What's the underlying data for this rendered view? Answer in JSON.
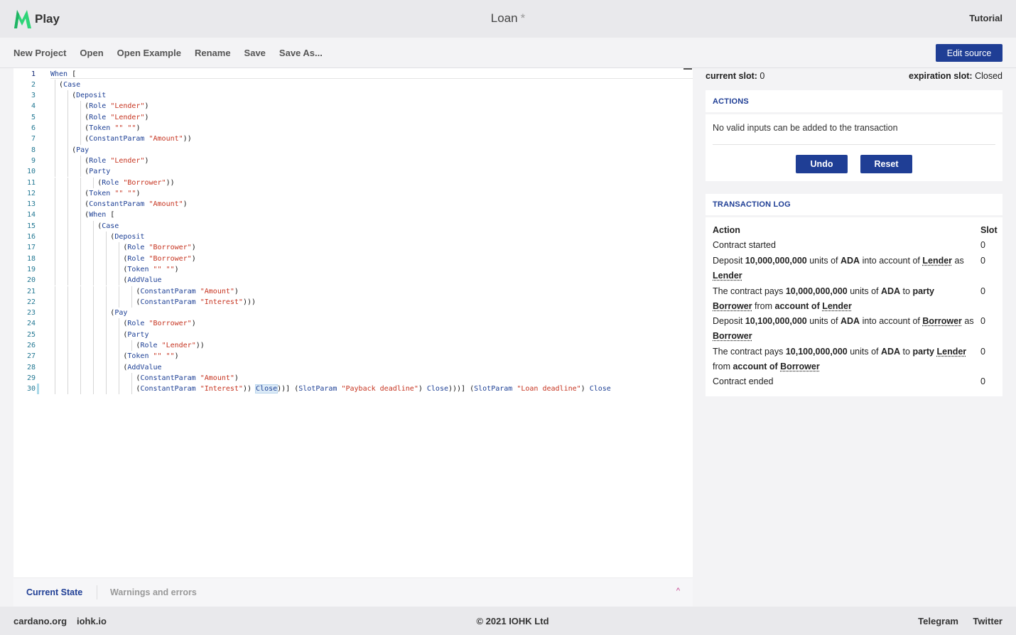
{
  "header": {
    "logo_text": "Play",
    "title": "Loan",
    "dirty_marker": "*",
    "tutorial": "Tutorial"
  },
  "toolbar": {
    "menu": [
      "New Project",
      "Open",
      "Open Example",
      "Rename",
      "Save",
      "Save As..."
    ],
    "edit_source": "Edit source"
  },
  "editor": {
    "lines": [
      "When [",
      "  (Case",
      "     (Deposit",
      "        (Role \"Lender\")",
      "        (Role \"Lender\")",
      "        (Token \"\" \"\")",
      "        (ConstantParam \"Amount\"))",
      "     (Pay",
      "        (Role \"Lender\")",
      "        (Party",
      "           (Role \"Borrower\"))",
      "        (Token \"\" \"\")",
      "        (ConstantParam \"Amount\")",
      "        (When [",
      "           (Case",
      "              (Deposit",
      "                 (Role \"Borrower\")",
      "                 (Role \"Borrower\")",
      "                 (Token \"\" \"\")",
      "                 (AddValue",
      "                    (ConstantParam \"Amount\")",
      "                    (ConstantParam \"Interest\")))",
      "              (Pay",
      "                 (Role \"Borrower\")",
      "                 (Party",
      "                    (Role \"Lender\"))",
      "                 (Token \"\" \"\")",
      "                 (AddValue",
      "                    (ConstantParam \"Amount\")",
      "                    (ConstantParam \"Interest\")) Close))] (SlotParam \"Payback deadline\") Close)))] (SlotParam \"Loan deadline\") Close"
    ]
  },
  "bottom_panel": {
    "tab_current": "Current State",
    "tab_warnings": "Warnings and errors",
    "chevron": "^"
  },
  "slots": {
    "current_label": "current slot:",
    "current_value": "0",
    "expiration_label": "expiration slot:",
    "expiration_value": "Closed"
  },
  "actions": {
    "heading": "ACTIONS",
    "message": "No valid inputs can be added to the transaction",
    "undo": "Undo",
    "reset": "Reset"
  },
  "transaction_log": {
    "heading": "TRANSACTION LOG",
    "col_action": "Action",
    "col_slot": "Slot",
    "rows": [
      {
        "slot": "0",
        "parts": [
          [
            "t",
            "Contract started"
          ]
        ]
      },
      {
        "slot": "0",
        "parts": [
          [
            "t",
            "Deposit "
          ],
          [
            "b",
            "10,000,000,000"
          ],
          [
            "t",
            " units of "
          ],
          [
            "b",
            "ADA"
          ],
          [
            "t",
            " into account of "
          ],
          [
            "u",
            "Lender"
          ],
          [
            "t",
            " as "
          ],
          [
            "u",
            "Lender"
          ]
        ]
      },
      {
        "slot": "0",
        "parts": [
          [
            "t",
            "The contract pays "
          ],
          [
            "b",
            "10,000,000,000"
          ],
          [
            "t",
            " units of "
          ],
          [
            "b",
            "ADA"
          ],
          [
            "t",
            " to "
          ],
          [
            "b",
            "party "
          ],
          [
            "u",
            "Borrower"
          ],
          [
            "t",
            " from "
          ],
          [
            "b",
            "account of "
          ],
          [
            "u",
            "Lender"
          ]
        ]
      },
      {
        "slot": "0",
        "parts": [
          [
            "t",
            "Deposit "
          ],
          [
            "b",
            "10,100,000,000"
          ],
          [
            "t",
            " units of "
          ],
          [
            "b",
            "ADA"
          ],
          [
            "t",
            " into account of "
          ],
          [
            "u",
            "Borrower"
          ],
          [
            "t",
            " as "
          ],
          [
            "u",
            "Borrower"
          ]
        ]
      },
      {
        "slot": "0",
        "parts": [
          [
            "t",
            "The contract pays "
          ],
          [
            "b",
            "10,100,000,000"
          ],
          [
            "t",
            " units of "
          ],
          [
            "b",
            "ADA"
          ],
          [
            "t",
            " to "
          ],
          [
            "b",
            "party "
          ],
          [
            "u",
            "Lender"
          ],
          [
            "t",
            " from "
          ],
          [
            "b",
            "account of "
          ],
          [
            "u",
            "Borrower"
          ]
        ]
      },
      {
        "slot": "0",
        "parts": [
          [
            "t",
            "Contract ended"
          ]
        ]
      }
    ]
  },
  "footer": {
    "link1": "cardano.org",
    "link2": "iohk.io",
    "copyright": "© 2021 IOHK Ltd",
    "link3": "Telegram",
    "link4": "Twitter"
  },
  "colors": {
    "accent": "#1f3e95",
    "string": "#c6331f",
    "keyword": "#1c3f95",
    "line_number": "#237893"
  }
}
